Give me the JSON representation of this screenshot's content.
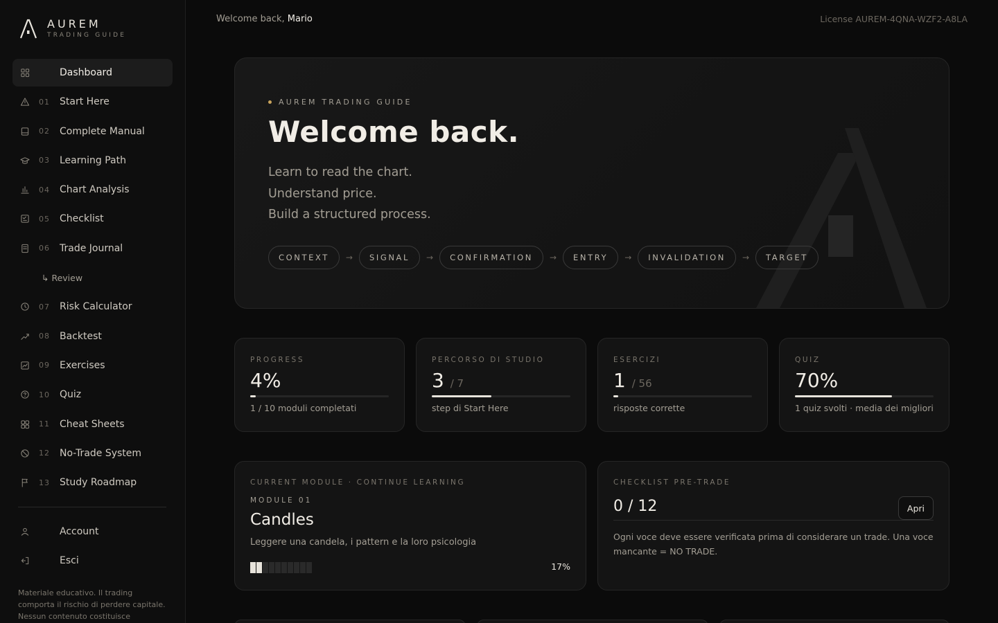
{
  "brand": {
    "name": "AUREM",
    "subtitle": "TRADING GUIDE"
  },
  "nav": [
    {
      "icon": "grid-icon",
      "num": "",
      "label": "Dashboard",
      "active": true
    },
    {
      "icon": "warning-icon",
      "num": "01",
      "label": "Start Here"
    },
    {
      "icon": "book-icon",
      "num": "02",
      "label": "Complete Manual"
    },
    {
      "icon": "graduation-cap-icon",
      "num": "03",
      "label": "Learning Path"
    },
    {
      "icon": "bar-chart-icon",
      "num": "04",
      "label": "Chart Analysis"
    },
    {
      "icon": "checklist-icon",
      "num": "05",
      "label": "Checklist"
    },
    {
      "icon": "journal-icon",
      "num": "06",
      "label": "Trade Journal"
    }
  ],
  "nav_sub": {
    "label": "↳ Review"
  },
  "nav_b": [
    {
      "icon": "clock-icon",
      "num": "07",
      "label": "Risk Calculator"
    },
    {
      "icon": "trend-up-icon",
      "num": "08",
      "label": "Backtest"
    },
    {
      "icon": "chart-box-icon",
      "num": "09",
      "label": "Exercises"
    },
    {
      "icon": "help-circle-icon",
      "num": "10",
      "label": "Quiz"
    },
    {
      "icon": "cards-icon",
      "num": "11",
      "label": "Cheat Sheets"
    },
    {
      "icon": "ban-icon",
      "num": "12",
      "label": "No-Trade System"
    },
    {
      "icon": "flag-icon",
      "num": "13",
      "label": "Study Roadmap"
    }
  ],
  "nav_footer": [
    {
      "icon": "user-icon",
      "label": "Account"
    },
    {
      "icon": "logout-icon",
      "label": "Esci"
    }
  ],
  "disclaimer": "Materiale educativo. Il trading comporta il rischio di perdere capitale. Nessun contenuto costituisce",
  "topbar": {
    "welcome_prefix": "Welcome back,",
    "user": "Mario",
    "license": "License AUREM-4QNA-WZF2-A8LA"
  },
  "hero": {
    "kicker": "AUREM TRADING GUIDE",
    "title": "Welcome back.",
    "lines": [
      "Learn to read the chart.",
      "Understand price.",
      "Build a structured process."
    ],
    "steps": [
      "CONTEXT",
      "SIGNAL",
      "CONFIRMATION",
      "ENTRY",
      "INVALIDATION",
      "TARGET"
    ],
    "arrow": "→"
  },
  "stats": [
    {
      "label": "PROGRESS",
      "value": "4%",
      "of": "",
      "progress": 0.04,
      "desc": "1 / 10 moduli completati"
    },
    {
      "label": "PERCORSO DI STUDIO",
      "value": "3",
      "of": "/ 7",
      "progress": 0.43,
      "desc": "step di Start Here"
    },
    {
      "label": "ESERCIZI",
      "value": "1",
      "of": "/ 56",
      "progress": 0.02,
      "desc": "risposte corrette"
    },
    {
      "label": "QUIZ",
      "value": "70%",
      "of": "",
      "progress": 0.7,
      "desc": "1 quiz svolti · media dei migliori"
    }
  ],
  "module": {
    "label": "CURRENT MODULE · CONTINUE LEARNING",
    "tag": "MODULE 01",
    "title": "Candles",
    "desc": "Leggere una candela, i pattern e la loro psicologia",
    "segments_total": 10,
    "segments_done": 2,
    "pct": "17%"
  },
  "checklist": {
    "label": "CHECKLIST PRE-TRADE",
    "value": "0 / 12",
    "button": "Apri",
    "desc": "Ogni voce deve essere verificata prima di considerare un trade. Una voce mancante = NO TRADE."
  },
  "colors": {
    "accent": "#c9a45c",
    "bg": "#0b0b0b",
    "card": "#141414",
    "text": "#e8e4dc"
  }
}
